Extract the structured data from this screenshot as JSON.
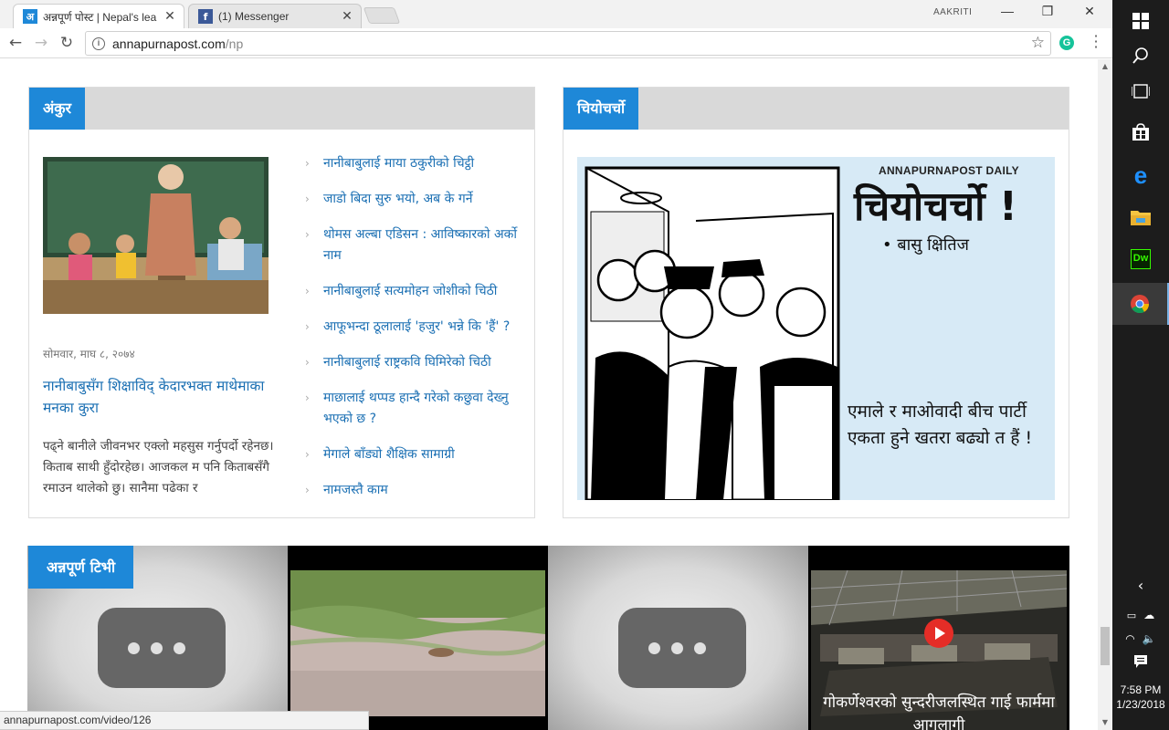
{
  "browser": {
    "tabs": [
      {
        "title": "अन्नपूर्ण पोस्ट | Nepal's lea",
        "favicon": "अ",
        "active": true
      },
      {
        "title": "(1) Messenger",
        "favicon": "f",
        "active": false
      }
    ],
    "profile": "AAKRITI",
    "url_host": "annapurnapost.com",
    "url_path": "/np",
    "status_url": "annapurnapost.com/video/126"
  },
  "ankur": {
    "title": "अंकुर",
    "date": "सोमवार, माघ ८, २०७४",
    "lead_title": "नानीबाबुसँग शिक्षाविद् केदारभक्त माथेमाका मनका कुरा",
    "lead_body": "पढ्ने बानीले जीवनभर एक्लो महसुस गर्नुपर्दो रहेनछ। किताब साथी हुँदोरहेछ। आजकल म पनि किताबसँगै रमाउन थालेको छु। सानैमा पढेका र",
    "links": [
      "नानीबाबुलाई माया ठकुरीको चिट्ठी",
      "जाडो बिदा सुरु भयो, अब के गर्ने",
      "थोमस अल्बा एडिसन : आविष्कारको अर्को नाम",
      "नानीबाबुलाई सत्यमोहन जोशीको चिठी",
      "आफूभन्दा ठूलालाई 'हजुर' भन्ने कि 'हैं' ?",
      "नानीबाबुलाई राष्ट्रकवि घिमिरेको चिठी",
      "माछालाई थप्पड हान्दै गरेको कछुवा देख्नु भएको छ ?",
      "मेगाले बाँड्यो शैक्षिक सामाग्री",
      "नामजस्तै काम"
    ]
  },
  "chiyo": {
    "title": "चियोचर्चो",
    "brand": "ANNAPURNAPOST DAILY",
    "heading": "चियोचर्चो !",
    "author": "• बासु क्षितिज",
    "caption": "एमाले र माओवादी बीच पार्टी एकता हुने खतरा बढ्यो त हैं !"
  },
  "tv": {
    "title": "अन्नपूर्ण टिभी",
    "video4_caption": "गोकर्णेश्वरको सुन्दरीजलस्थित गाई फार्ममा आगलागी"
  },
  "system": {
    "time": "7:58 PM",
    "date": "1/23/2018"
  },
  "icons": [
    "windows-start-icon",
    "search-icon",
    "task-view-icon",
    "store-icon",
    "edge-icon",
    "file-explorer-icon",
    "dreamweaver-icon",
    "chrome-icon"
  ],
  "colors": {
    "accent": "#1e88d8",
    "link": "#1a6fb3"
  }
}
